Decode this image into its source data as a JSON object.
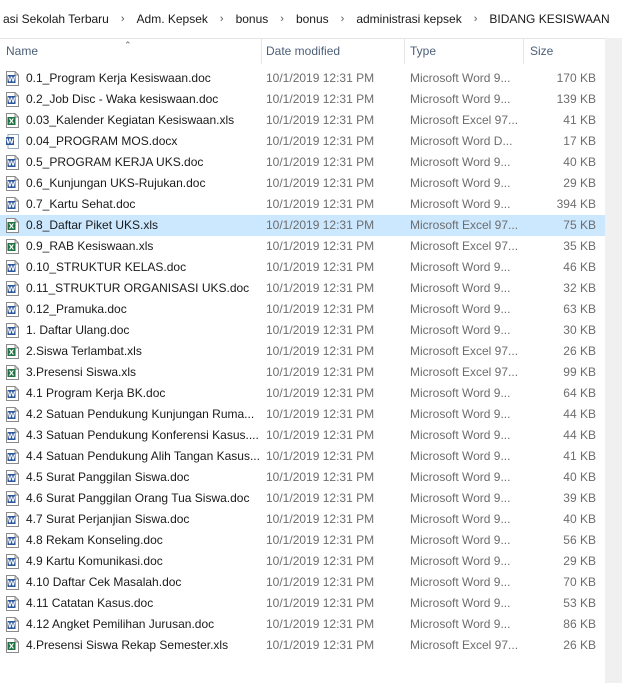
{
  "breadcrumb": [
    "asi Sekolah Terbaru",
    "Adm. Kepsek",
    "bonus",
    "bonus",
    "administrasi kepsek",
    "BIDANG KESISWAAN"
  ],
  "columns": {
    "name": "Name",
    "date": "Date modified",
    "type": "Type",
    "size": "Size"
  },
  "colors": {
    "word": "#2b579a",
    "excel": "#217346",
    "selected": "#cce8ff"
  },
  "files": [
    {
      "name": "0.1_Program Kerja Kesiswaan.doc",
      "date": "10/1/2019 12:31 PM",
      "type": "Microsoft Word 9...",
      "size": "170 KB",
      "icon": "word-doc-icon"
    },
    {
      "name": "0.2_Job Disc - Waka kesiswaan.doc",
      "date": "10/1/2019 12:31 PM",
      "type": "Microsoft Word 9...",
      "size": "139 KB",
      "icon": "word-doc-icon"
    },
    {
      "name": "0.03_Kalender Kegiatan Kesiswaan.xls",
      "date": "10/1/2019 12:31 PM",
      "type": "Microsoft Excel 97...",
      "size": "41 KB",
      "icon": "excel-doc-icon"
    },
    {
      "name": "0.04_PROGRAM MOS.docx",
      "date": "10/1/2019 12:31 PM",
      "type": "Microsoft Word D...",
      "size": "17 KB",
      "icon": "word-docx-icon"
    },
    {
      "name": "0.5_PROGRAM KERJA UKS.doc",
      "date": "10/1/2019 12:31 PM",
      "type": "Microsoft Word 9...",
      "size": "40 KB",
      "icon": "word-doc-icon"
    },
    {
      "name": "0.6_Kunjungan UKS-Rujukan.doc",
      "date": "10/1/2019 12:31 PM",
      "type": "Microsoft Word 9...",
      "size": "29 KB",
      "icon": "word-doc-icon"
    },
    {
      "name": "0.7_Kartu Sehat.doc",
      "date": "10/1/2019 12:31 PM",
      "type": "Microsoft Word 9...",
      "size": "394 KB",
      "icon": "word-doc-icon"
    },
    {
      "name": "0.8_Daftar Piket UKS.xls",
      "date": "10/1/2019 12:31 PM",
      "type": "Microsoft Excel 97...",
      "size": "75 KB",
      "icon": "excel-doc-icon",
      "selected": true
    },
    {
      "name": "0.9_RAB Kesiswaan.xls",
      "date": "10/1/2019 12:31 PM",
      "type": "Microsoft Excel 97...",
      "size": "35 KB",
      "icon": "excel-doc-icon"
    },
    {
      "name": "0.10_STRUKTUR KELAS.doc",
      "date": "10/1/2019 12:31 PM",
      "type": "Microsoft Word 9...",
      "size": "46 KB",
      "icon": "word-doc-icon"
    },
    {
      "name": "0.11_STRUKTUR ORGANISASI UKS.doc",
      "date": "10/1/2019 12:31 PM",
      "type": "Microsoft Word 9...",
      "size": "32 KB",
      "icon": "word-doc-icon"
    },
    {
      "name": "0.12_Pramuka.doc",
      "date": "10/1/2019 12:31 PM",
      "type": "Microsoft Word 9...",
      "size": "63 KB",
      "icon": "word-doc-icon"
    },
    {
      "name": "1. Daftar Ulang.doc",
      "date": "10/1/2019 12:31 PM",
      "type": "Microsoft Word 9...",
      "size": "30 KB",
      "icon": "word-doc-icon"
    },
    {
      "name": "2.Siswa Terlambat.xls",
      "date": "10/1/2019 12:31 PM",
      "type": "Microsoft Excel 97...",
      "size": "26 KB",
      "icon": "excel-doc-icon"
    },
    {
      "name": "3.Presensi Siswa.xls",
      "date": "10/1/2019 12:31 PM",
      "type": "Microsoft Excel 97...",
      "size": "99 KB",
      "icon": "excel-doc-icon"
    },
    {
      "name": "4.1 Program Kerja BK.doc",
      "date": "10/1/2019 12:31 PM",
      "type": "Microsoft Word 9...",
      "size": "64 KB",
      "icon": "word-doc-icon"
    },
    {
      "name": "4.2 Satuan Pendukung Kunjungan Ruma...",
      "date": "10/1/2019 12:31 PM",
      "type": "Microsoft Word 9...",
      "size": "44 KB",
      "icon": "word-doc-icon"
    },
    {
      "name": "4.3 Satuan Pendukung Konferensi Kasus....",
      "date": "10/1/2019 12:31 PM",
      "type": "Microsoft Word 9...",
      "size": "44 KB",
      "icon": "word-doc-icon"
    },
    {
      "name": "4.4 Satuan Pendukung Alih Tangan Kasus...",
      "date": "10/1/2019 12:31 PM",
      "type": "Microsoft Word 9...",
      "size": "41 KB",
      "icon": "word-doc-icon"
    },
    {
      "name": "4.5 Surat Panggilan Siswa.doc",
      "date": "10/1/2019 12:31 PM",
      "type": "Microsoft Word 9...",
      "size": "40 KB",
      "icon": "word-doc-icon"
    },
    {
      "name": "4.6 Surat Panggilan Orang Tua Siswa.doc",
      "date": "10/1/2019 12:31 PM",
      "type": "Microsoft Word 9...",
      "size": "39 KB",
      "icon": "word-doc-icon"
    },
    {
      "name": "4.7 Surat Perjanjian Siswa.doc",
      "date": "10/1/2019 12:31 PM",
      "type": "Microsoft Word 9...",
      "size": "40 KB",
      "icon": "word-doc-icon"
    },
    {
      "name": "4.8 Rekam Konseling.doc",
      "date": "10/1/2019 12:31 PM",
      "type": "Microsoft Word 9...",
      "size": "56 KB",
      "icon": "word-doc-icon"
    },
    {
      "name": "4.9 Kartu Komunikasi.doc",
      "date": "10/1/2019 12:31 PM",
      "type": "Microsoft Word 9...",
      "size": "29 KB",
      "icon": "word-doc-icon"
    },
    {
      "name": "4.10 Daftar Cek Masalah.doc",
      "date": "10/1/2019 12:31 PM",
      "type": "Microsoft Word 9...",
      "size": "70 KB",
      "icon": "word-doc-icon"
    },
    {
      "name": "4.11 Catatan Kasus.doc",
      "date": "10/1/2019 12:31 PM",
      "type": "Microsoft Word 9...",
      "size": "53 KB",
      "icon": "word-doc-icon"
    },
    {
      "name": "4.12 Angket Pemilihan Jurusan.doc",
      "date": "10/1/2019 12:31 PM",
      "type": "Microsoft Word 9...",
      "size": "86 KB",
      "icon": "word-doc-icon"
    },
    {
      "name": "4.Presensi Siswa Rekap Semester.xls",
      "date": "10/1/2019 12:31 PM",
      "type": "Microsoft Excel 97...",
      "size": "26 KB",
      "icon": "excel-doc-icon"
    }
  ]
}
